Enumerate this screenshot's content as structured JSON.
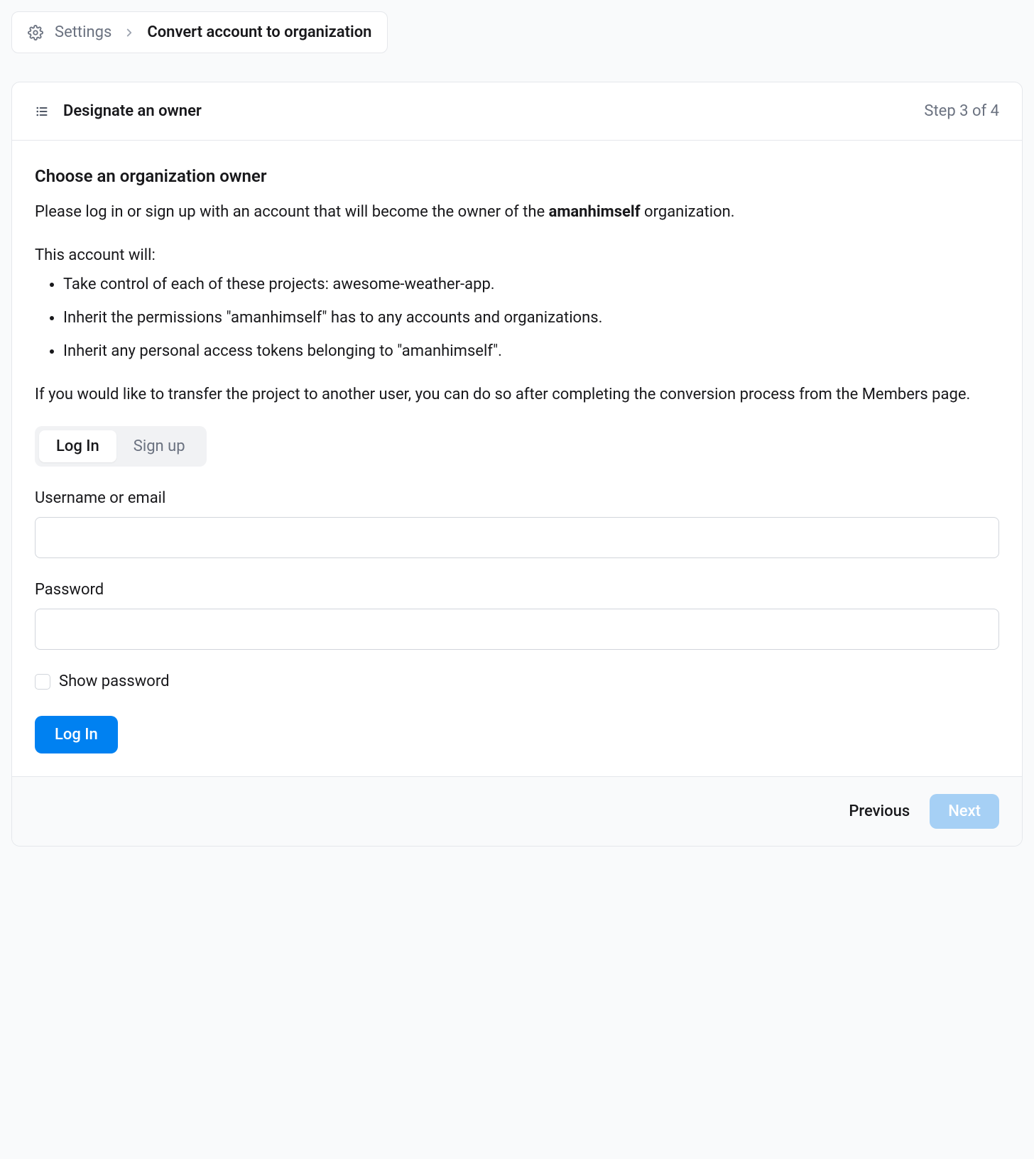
{
  "breadcrumb": {
    "settings_label": "Settings",
    "current_label": "Convert account to organization"
  },
  "header": {
    "title": "Designate an owner",
    "step_text": "Step 3 of 4"
  },
  "content": {
    "section_title": "Choose an organization owner",
    "intro_prefix": "Please log in or sign up with an account that will become the owner of the ",
    "org_name": "amanhimself",
    "intro_suffix": " organization.",
    "list_intro": "This account will:",
    "bullets": [
      "Take control of each of these projects: awesome-weather-app.",
      "Inherit the permissions \"amanhimself\" has to any accounts and organizations.",
      "Inherit any personal access tokens belonging to \"amanhimself\"."
    ],
    "transfer_note": "If you would like to transfer the project to another user, you can do so after completing the conversion process from the Members page."
  },
  "tabs": {
    "login": "Log In",
    "signup": "Sign up"
  },
  "form": {
    "username_label": "Username or email",
    "username_value": "",
    "password_label": "Password",
    "password_value": "",
    "show_password_label": "Show password",
    "submit_label": "Log In"
  },
  "footer": {
    "previous_label": "Previous",
    "next_label": "Next"
  }
}
